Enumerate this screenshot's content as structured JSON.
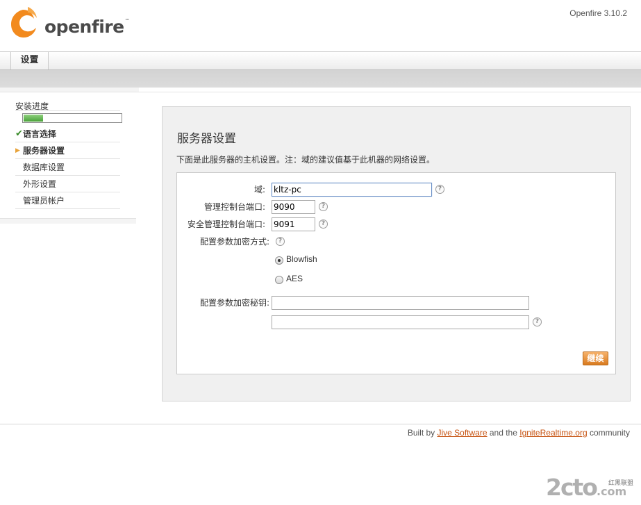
{
  "header": {
    "brand": "openfire",
    "brand_tm": "™",
    "version": "Openfire 3.10.2"
  },
  "nav": {
    "tab_label": "设置"
  },
  "sidebar": {
    "progress_label": "安装进度",
    "progress_fraction": 0.2,
    "steps": [
      {
        "label": "语言选择",
        "state": "done",
        "mark": "✔"
      },
      {
        "label": "服务器设置",
        "state": "current",
        "mark": "▶"
      },
      {
        "label": "数据库设置",
        "state": "pending",
        "mark": ""
      },
      {
        "label": "外形设置",
        "state": "pending",
        "mark": ""
      },
      {
        "label": "管理员帐户",
        "state": "pending",
        "mark": ""
      }
    ]
  },
  "main": {
    "title": "服务器设置",
    "description": "下面是此服务器的主机设置。注：域的建议值基于此机器的网络设置。",
    "fields": {
      "domain_label": "域:",
      "domain_value": "kltz-pc",
      "admin_port_label": "管理控制台端口:",
      "admin_port_value": "9090",
      "secure_port_label": "安全管理控制台端口:",
      "secure_port_value": "9091",
      "encryption_label": "配置参数加密方式:",
      "encryption_options": [
        "Blowfish",
        "AES"
      ],
      "encryption_selected": "Blowfish",
      "key_label": "配置参数加密秘钥:",
      "key_value": "",
      "key_confirm_value": ""
    },
    "continue_label": "继续",
    "help_glyph": "?"
  },
  "footer": {
    "prefix": "Built by ",
    "link1": "Jive Software",
    "middle": " and the ",
    "link2": "IgniteRealtime.org",
    "suffix": " community"
  },
  "watermark": {
    "text": "2cto",
    "suffix": ".com",
    "sub": "红黑联盟"
  },
  "colors": {
    "accent": "#e8a33a",
    "link": "#c6510f",
    "progress": "#4aa23a",
    "button": "#d97a1f"
  }
}
